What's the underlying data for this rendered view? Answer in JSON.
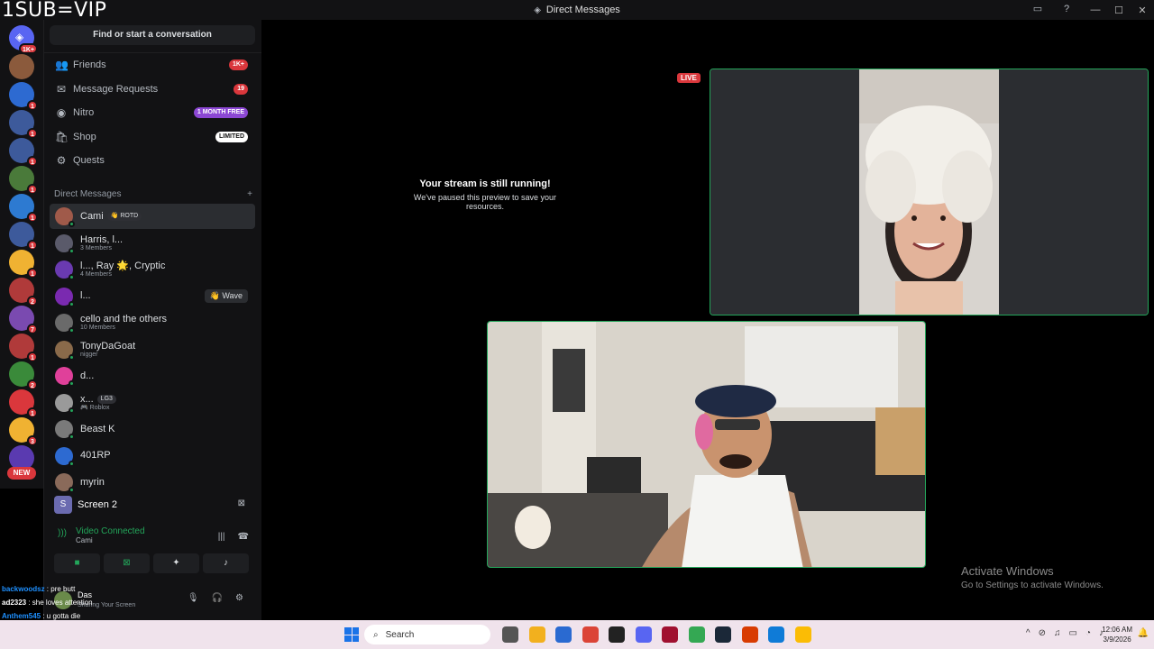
{
  "overlay_text": "1SUB=VIP",
  "window": {
    "title": "Direct Messages",
    "minimize": "—",
    "maximize": "☐",
    "close": "✕",
    "inbox_icon": "inbox-icon",
    "help_icon": "help-icon"
  },
  "rail": {
    "home_badge": "1K+",
    "servers": [
      {
        "badge": "",
        "color": "#8b5a3c"
      },
      {
        "badge": "1",
        "color": "#2d6ad1"
      },
      {
        "badge": "1",
        "color": "#3d5a9b"
      },
      {
        "badge": "1",
        "color": "#3d5a9b"
      },
      {
        "badge": "1",
        "color": "#4a7a3a"
      },
      {
        "badge": "1",
        "color": "#2d7ad1"
      },
      {
        "badge": "1",
        "color": "#3d5a9b"
      },
      {
        "badge": "1",
        "color": "#f0b232"
      },
      {
        "badge": "2",
        "color": "#b03a3a"
      },
      {
        "badge": "7",
        "color": "#7a4ab0"
      },
      {
        "badge": "1",
        "color": "#b03a3a"
      },
      {
        "badge": "2",
        "color": "#3a8a3a"
      },
      {
        "badge": "1",
        "color": "#da373c"
      },
      {
        "badge": "3",
        "color": "#f0b232"
      },
      {
        "badge": "",
        "color": "#5a3ab0"
      }
    ],
    "new_label": "NEW"
  },
  "sidebar": {
    "search_label": "Find or start a conversation",
    "nav": [
      {
        "label": "Friends",
        "tag": "1K+",
        "icon": "friends-icon",
        "glyph": "👥"
      },
      {
        "label": "Message Requests",
        "tag": "19",
        "icon": "mail-icon",
        "glyph": "✉"
      },
      {
        "label": "Nitro",
        "tag": "1 MONTH FREE",
        "icon": "nitro-icon",
        "glyph": "◉"
      },
      {
        "label": "Shop",
        "tag": "LIMITED",
        "icon": "shop-icon",
        "glyph": "🛍"
      },
      {
        "label": "Quests",
        "tag": "",
        "icon": "quests-icon",
        "glyph": "⚙"
      }
    ],
    "dm_header": "Direct Messages",
    "dm_add": "+",
    "dms": [
      {
        "name": "Cami",
        "sub": "",
        "chip": "👋 ROTD",
        "color": "#a05a4a",
        "active": true
      },
      {
        "name": "Harris, l...",
        "sub": "3 Members",
        "chip": "",
        "color": "#5a5a6a"
      },
      {
        "name": "l..., Ray 🌟, Cryptic",
        "sub": "4 Members",
        "chip": "",
        "color": "#6a3ab0"
      },
      {
        "name": "l...",
        "sub": "",
        "chip": "",
        "color": "#7a2ab0",
        "wave": "👋 Wave"
      },
      {
        "name": "cello and the others",
        "sub": "10 Members",
        "chip": "",
        "color": "#6a6a6a"
      },
      {
        "name": "TonyDaGoat",
        "sub": "nigger",
        "chip": "",
        "color": "#8a6a4a"
      },
      {
        "name": "d...",
        "sub": "",
        "chip": "",
        "color": "#e0409a"
      },
      {
        "name": "x...",
        "sub": "🎮 Roblox",
        "chip": "LG3",
        "color": "#9a9a9a"
      },
      {
        "name": "Beast K",
        "sub": "",
        "chip": "",
        "color": "#7a7a7a"
      },
      {
        "name": "401RP",
        "sub": "",
        "chip": "",
        "color": "#2d6ad1"
      },
      {
        "name": "myrin",
        "sub": "",
        "chip": "",
        "color": "#8a6a5a"
      }
    ]
  },
  "voice_panel": {
    "screen_initial": "S",
    "screen_name": "Screen 2",
    "status": "Video Connected",
    "channel": "Cami",
    "user_name": "Das",
    "user_status": "Sharing Your Screen"
  },
  "chat_overlay": [
    {
      "user": "backwoodsz",
      "msg": " : pre butt",
      "color": "#1e90ff"
    },
    {
      "user": "ad2323",
      "msg": " : she loves attention",
      "color": "#ffffff"
    },
    {
      "user": "Anthem545",
      "msg": " : u gotta die",
      "color": "#1e90ff"
    }
  ],
  "main": {
    "paused_title": "Your stream is still running!",
    "paused_sub": "We've paused this preview to save your resources.",
    "live_label": "LIVE",
    "activate_title": "Activate Windows",
    "activate_sub": "Go to Settings to activate Windows."
  },
  "taskbar": {
    "search_label": "Search",
    "time": "12:06 AM",
    "date": "3/9/2026",
    "apps": [
      {
        "name": "files-app-icon",
        "color": "#555"
      },
      {
        "name": "explorer-icon",
        "color": "#f2b01e"
      },
      {
        "name": "store-icon",
        "color": "#2a6ad1"
      },
      {
        "name": "chrome-icon",
        "color": "#db4437"
      },
      {
        "name": "game-icon",
        "color": "#222"
      },
      {
        "name": "discord-icon",
        "color": "#5865f2"
      },
      {
        "name": "adobe-icon",
        "color": "#a01030"
      },
      {
        "name": "chrome2-icon",
        "color": "#34a853"
      },
      {
        "name": "steam-icon",
        "color": "#1b2838"
      },
      {
        "name": "office-icon",
        "color": "#d83b01"
      },
      {
        "name": "edge-icon",
        "color": "#0f7bd7"
      },
      {
        "name": "chrome3-icon",
        "color": "#fbbc05"
      }
    ]
  }
}
